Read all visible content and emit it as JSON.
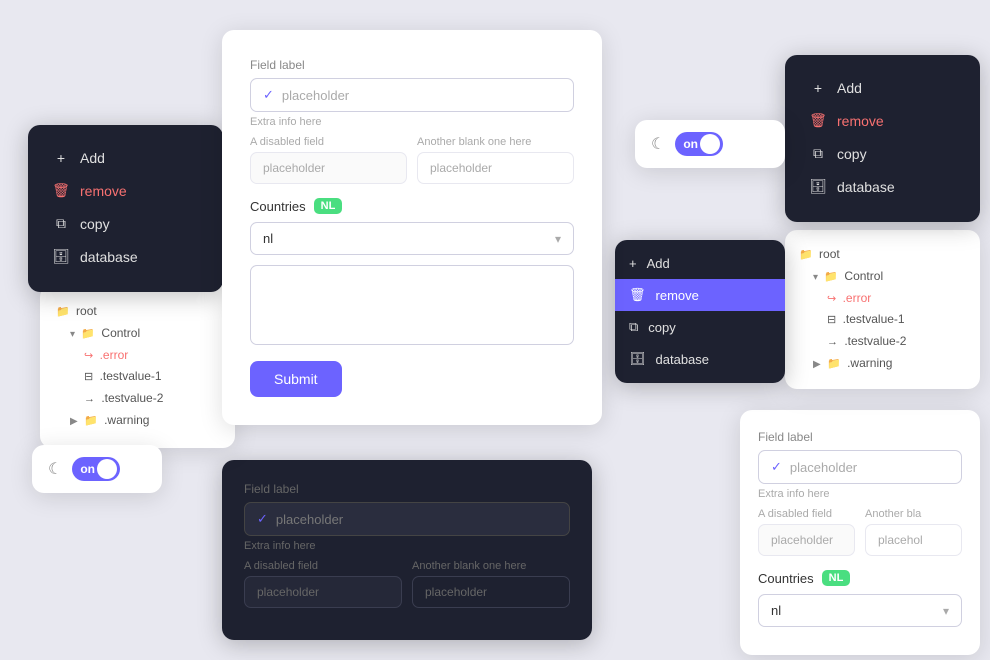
{
  "colors": {
    "accent": "#6c63ff",
    "danger": "#f87171",
    "success": "#4ade80",
    "dark_bg": "#1e2130",
    "card_bg": "#fff"
  },
  "main_form": {
    "field_label": "Field label",
    "placeholder": "placeholder",
    "extra_info": "Extra info here",
    "disabled_label": "A disabled field",
    "blank_label": "Another blank one here",
    "disabled_placeholder": "placeholder",
    "blank_placeholder": "placeholder",
    "countries_label": "Countries",
    "nl_badge": "NL",
    "select_value": "nl",
    "submit_label": "Submit"
  },
  "dark_menu_left": {
    "add_label": "Add",
    "remove_label": "remove",
    "copy_label": "copy",
    "database_label": "database"
  },
  "tree_left": {
    "root_label": "root",
    "control_label": "Control",
    "error_label": ".error",
    "testvalue1_label": ".testvalue-1",
    "testvalue2_label": ".testvalue-2",
    "warning_label": ".warning"
  },
  "toggle_left": {
    "on_label": "on"
  },
  "toggle_right": {
    "on_label": "on"
  },
  "dark_menu_right": {
    "add_label": "Add",
    "remove_label": "remove",
    "copy_label": "copy",
    "database_label": "database"
  },
  "dropdown_menu": {
    "add_label": "Add",
    "remove_label": "remove",
    "copy_label": "copy",
    "database_label": "database"
  },
  "tree_right": {
    "root_label": "root",
    "control_label": "Control",
    "error_label": ".error",
    "testvalue1_label": ".testvalue-1",
    "testvalue2_label": ".testvalue-2",
    "warning_label": ".warning"
  },
  "bottom_dark_form": {
    "field_label": "Field label",
    "placeholder": "placeholder",
    "extra_info": "Extra info here",
    "disabled_label": "A disabled field",
    "blank_label": "Another blank one here",
    "disabled_placeholder": "placeholder",
    "blank_placeholder": "placeholder"
  },
  "bottom_right_form": {
    "field_label": "Field label",
    "placeholder": "placeholder",
    "extra_info": "Extra info here",
    "disabled_label": "A disabled field",
    "blank_label": "Another bla",
    "disabled_placeholder": "placeholder",
    "blank_placeholder": "placehol",
    "countries_label": "Countries",
    "nl_badge": "NL",
    "select_value": "nl"
  }
}
